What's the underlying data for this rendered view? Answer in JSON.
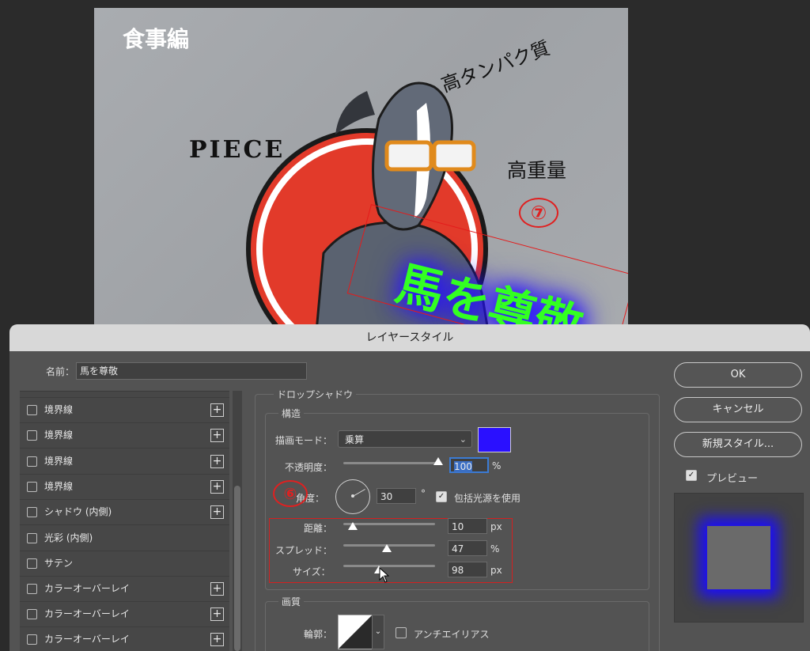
{
  "canvas": {
    "section_label": "食事編",
    "piece_text": "PIECE",
    "protein_text": "高タンパク質",
    "weight_text": "高重量",
    "annotation_7": "⑦",
    "main_text": "馬を尊敬",
    "colors": {
      "main_text": "#33ff22",
      "glow": "#2a14ff",
      "annotation": "#e02020"
    }
  },
  "dialog": {
    "title": "レイヤースタイル",
    "name_label": "名前：",
    "name_value": "馬を尊敬"
  },
  "style_list": {
    "items": [
      {
        "label": "境界線",
        "has_add": true
      },
      {
        "label": "境界線",
        "has_add": true
      },
      {
        "label": "境界線",
        "has_add": true
      },
      {
        "label": "境界線",
        "has_add": true
      },
      {
        "label": "シャドウ (内側)",
        "has_add": true
      },
      {
        "label": "光彩 (内側)",
        "has_add": false
      },
      {
        "label": "サテン",
        "has_add": false
      },
      {
        "label": "カラーオーバーレイ",
        "has_add": true
      },
      {
        "label": "カラーオーバーレイ",
        "has_add": true
      },
      {
        "label": "カラーオーバーレイ",
        "has_add": true
      }
    ],
    "add_icon": "+"
  },
  "drop_shadow": {
    "section_title": "ドロップシャドウ",
    "structure_title": "構造",
    "blend_mode_label": "描画モード：",
    "blend_mode_value": "乗算",
    "shadow_color": "#2a10ff",
    "opacity_label": "不透明度：",
    "opacity_value": "100",
    "opacity_unit": "%",
    "opacity_level": 1.0,
    "angle_label": "角度：",
    "angle_value": "30",
    "angle_unit": "°",
    "global_light_label": "包括光源を使用",
    "global_light_checked": true,
    "distance_label": "距離：",
    "distance_value": "10",
    "distance_unit": "px",
    "distance_level": 0.1,
    "spread_label": "スプレッド：",
    "spread_value": "47",
    "spread_unit": "%",
    "spread_level": 0.47,
    "size_label": "サイズ：",
    "size_value": "98",
    "size_unit": "px",
    "size_level": 0.39,
    "annotation_6": "⑥",
    "quality_title": "画質",
    "contour_label": "輪郭：",
    "antialias_label": "アンチエイリアス",
    "antialias_checked": false
  },
  "buttons": {
    "ok": "OK",
    "cancel": "キャンセル",
    "new_style": "新規スタイル...",
    "preview_label": "プレビュー",
    "preview_checked": true
  }
}
